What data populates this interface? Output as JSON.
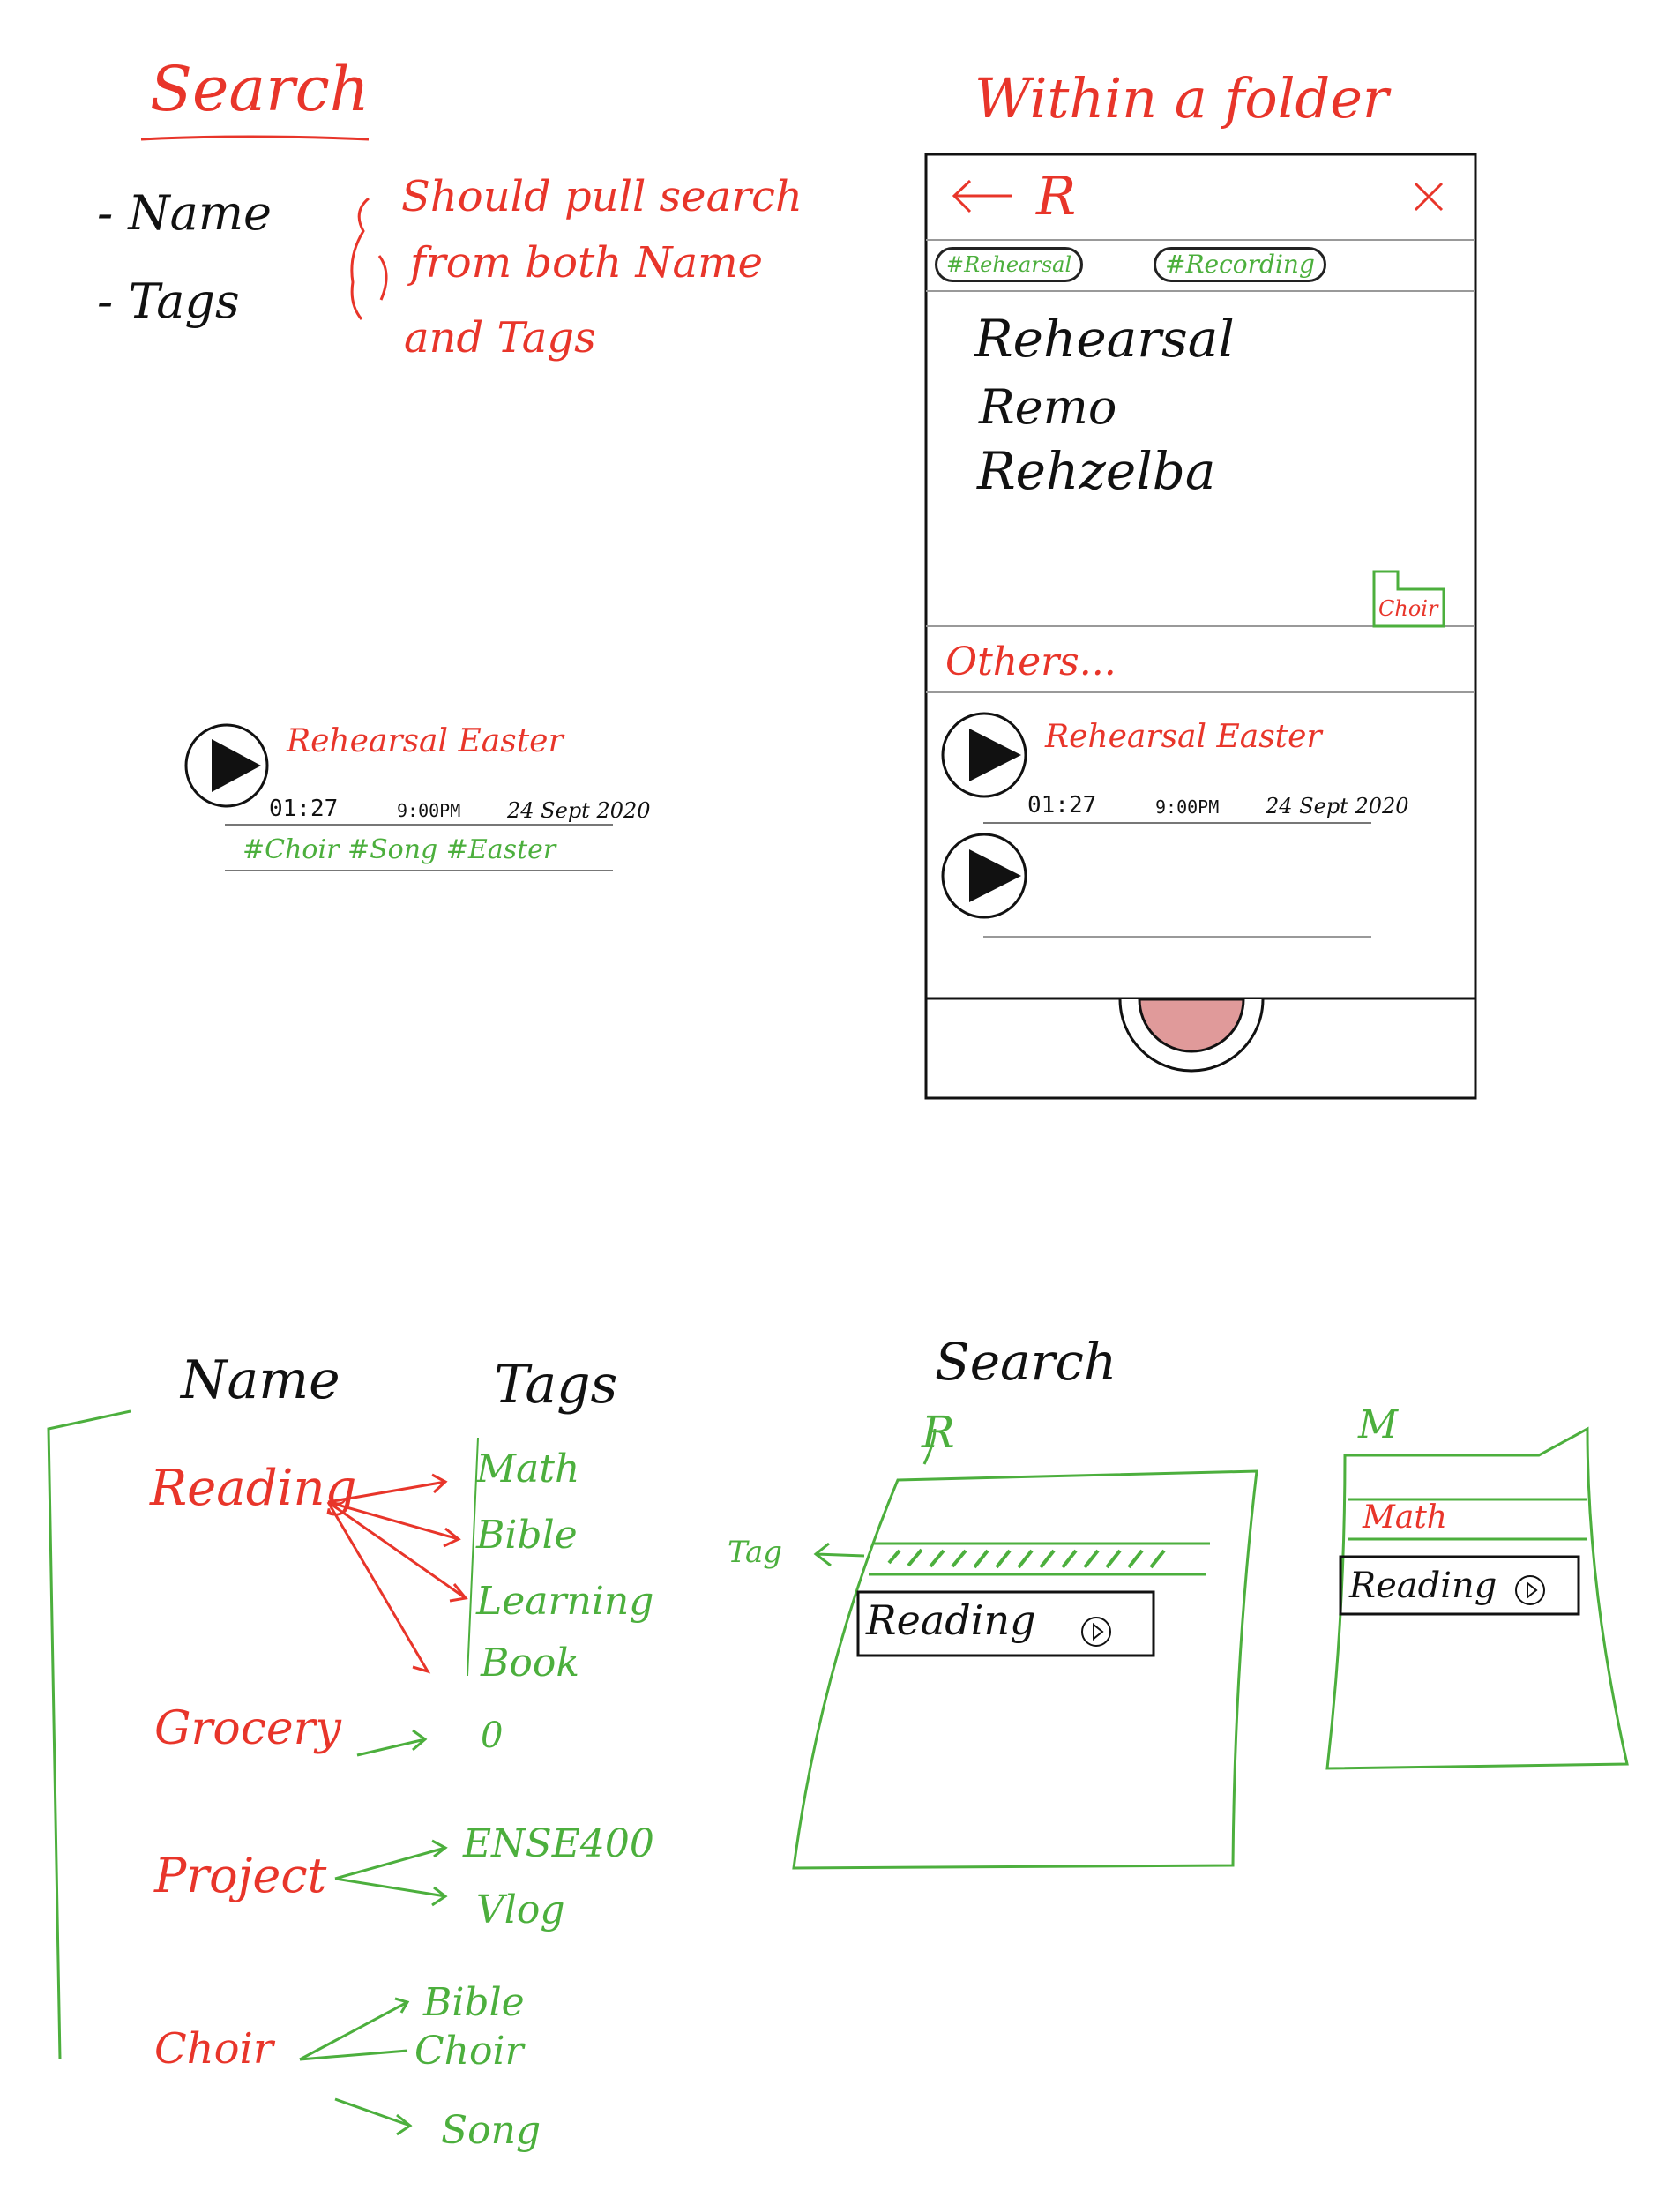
{
  "top_left": {
    "title": "Search",
    "items": [
      "- Name",
      "- Tags"
    ],
    "note_lines": [
      "Should pull search",
      "from both Name",
      "and Tags"
    ]
  },
  "recording_card": {
    "title": "Rehearsal Easter",
    "duration": "01:27",
    "time": "9:00PM",
    "date": "24 Sept 2020",
    "tags": "#Choir #Song #Easter"
  },
  "phone": {
    "caption": "Within a folder",
    "search_query": "R",
    "back_icon": "arrow-left-icon",
    "close_icon": "close-icon",
    "tag_chips": [
      "#Rehearsal",
      "#Recording"
    ],
    "results": [
      "Rehearsal",
      "Remo",
      "Rehzelba"
    ],
    "folder_label": "Choir",
    "others_label": "Others...",
    "others_card": {
      "title": "Rehearsal Easter",
      "duration": "01:27",
      "time": "9:00PM",
      "date": "24 Sept 2020"
    },
    "record_button_color": "#e09a9a"
  },
  "mapping": {
    "name_header": "Name",
    "tags_header": "Tags",
    "rows": [
      {
        "name": "Reading",
        "tags": [
          "Math",
          "Bible",
          "Learning",
          "Book"
        ]
      },
      {
        "name": "Grocery",
        "tags": [
          "0"
        ]
      },
      {
        "name": "Project",
        "tags": [
          "ENSE400",
          "Vlog"
        ]
      },
      {
        "name": "Choir",
        "tags": [
          "Bible",
          "Choir",
          "Song"
        ]
      }
    ]
  },
  "search_sketch": {
    "title": "Search",
    "query_r": "R",
    "tag_label": "Tag",
    "result_label": "Reading",
    "query_m": "M",
    "tag_math": "Math",
    "result_label_2": "Reading"
  },
  "colors": {
    "red": "#e8352a",
    "green": "#4caf3d",
    "ink": "#111111"
  }
}
